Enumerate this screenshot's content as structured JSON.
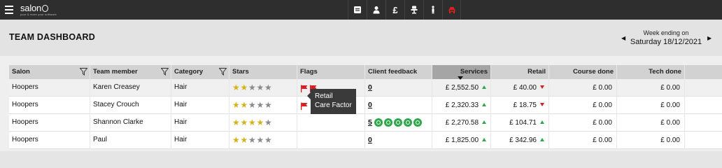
{
  "app": {
    "logo_text": "salon",
    "logo_tagline": "your & more your software"
  },
  "topbar": {
    "icons": [
      "calendar-icon",
      "person-icon",
      "pound-icon",
      "chair-icon",
      "staff-icon",
      "car-icon"
    ],
    "pound_glyph": "£"
  },
  "header": {
    "title": "TEAM DASHBOARD",
    "week_label": "Week ending on",
    "week_value": "Saturday 18/12/2021"
  },
  "table": {
    "columns": [
      {
        "label": "Salon"
      },
      {
        "label": "Team member"
      },
      {
        "label": "Category"
      },
      {
        "label": "Stars"
      },
      {
        "label": "Flags"
      },
      {
        "label": "Client feedback"
      },
      {
        "label": "Services"
      },
      {
        "label": "Retail"
      },
      {
        "label": "Course done"
      },
      {
        "label": "Tech done"
      }
    ],
    "rows": [
      {
        "salon": "Hoopers",
        "member": "Karen Creasey",
        "category": "Hair",
        "stars": 2,
        "flags": 2,
        "feedback": "0",
        "feedback_circles": 0,
        "services": "£ 2,552.50",
        "services_trend": "up",
        "retail": "£ 40.00",
        "retail_trend": "down",
        "course": "£ 0.00",
        "tech": "£ 0.00"
      },
      {
        "salon": "Hoopers",
        "member": "Stacey Crouch",
        "category": "Hair",
        "stars": 2,
        "flags": 1,
        "feedback": "0",
        "feedback_circles": 0,
        "services": "£ 2,320.33",
        "services_trend": "up",
        "retail": "£ 18.75",
        "retail_trend": "down",
        "course": "£ 0.00",
        "tech": "£ 0.00"
      },
      {
        "salon": "Hoopers",
        "member": "Shannon Clarke",
        "category": "Hair",
        "stars": 4,
        "flags": 0,
        "feedback": "5",
        "feedback_circles": 5,
        "services": "£ 2,270.58",
        "services_trend": "up",
        "retail": "£ 104.71",
        "retail_trend": "up",
        "course": "£ 0.00",
        "tech": "£ 0.00"
      },
      {
        "salon": "Hoopers",
        "member": "Paul",
        "category": "Hair",
        "stars": 2,
        "flags": 0,
        "feedback": "0",
        "feedback_circles": 0,
        "services": "£ 1,825.00",
        "services_trend": "up",
        "retail": "£ 342.96",
        "retail_trend": "up",
        "course": "£ 0.00",
        "tech": "£ 0.00"
      }
    ]
  },
  "tooltip": {
    "lines": [
      "Retail",
      "Care Factor"
    ]
  },
  "colors": {
    "topbar": "#2e2e2e",
    "active_icon": "#e02020",
    "star_on": "#d4b21a",
    "star_off": "#8a8a8a",
    "trend_up": "#2ea84a",
    "trend_down": "#d42020",
    "flag": "#d42020"
  }
}
